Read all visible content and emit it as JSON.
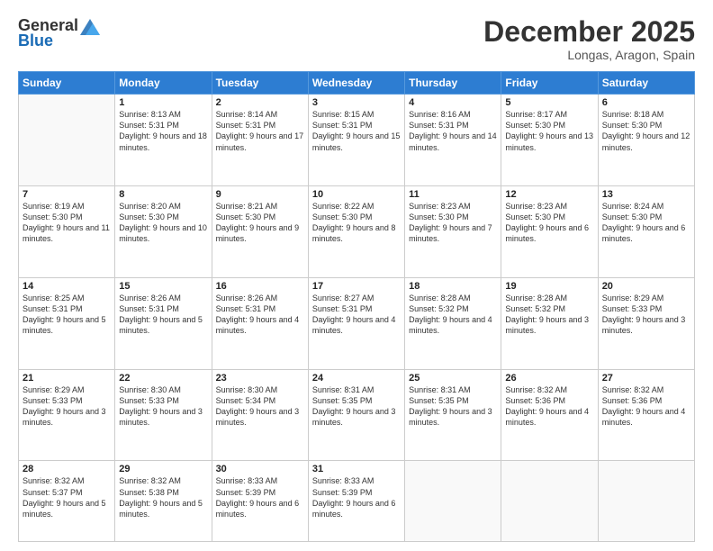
{
  "logo": {
    "general": "General",
    "blue": "Blue"
  },
  "title": {
    "month": "December 2025",
    "location": "Longas, Aragon, Spain"
  },
  "weekdays": [
    "Sunday",
    "Monday",
    "Tuesday",
    "Wednesday",
    "Thursday",
    "Friday",
    "Saturday"
  ],
  "weeks": [
    [
      {
        "day": "",
        "sunrise": "",
        "sunset": "",
        "daylight": ""
      },
      {
        "day": "1",
        "sunrise": "Sunrise: 8:13 AM",
        "sunset": "Sunset: 5:31 PM",
        "daylight": "Daylight: 9 hours and 18 minutes."
      },
      {
        "day": "2",
        "sunrise": "Sunrise: 8:14 AM",
        "sunset": "Sunset: 5:31 PM",
        "daylight": "Daylight: 9 hours and 17 minutes."
      },
      {
        "day": "3",
        "sunrise": "Sunrise: 8:15 AM",
        "sunset": "Sunset: 5:31 PM",
        "daylight": "Daylight: 9 hours and 15 minutes."
      },
      {
        "day": "4",
        "sunrise": "Sunrise: 8:16 AM",
        "sunset": "Sunset: 5:31 PM",
        "daylight": "Daylight: 9 hours and 14 minutes."
      },
      {
        "day": "5",
        "sunrise": "Sunrise: 8:17 AM",
        "sunset": "Sunset: 5:30 PM",
        "daylight": "Daylight: 9 hours and 13 minutes."
      },
      {
        "day": "6",
        "sunrise": "Sunrise: 8:18 AM",
        "sunset": "Sunset: 5:30 PM",
        "daylight": "Daylight: 9 hours and 12 minutes."
      }
    ],
    [
      {
        "day": "7",
        "sunrise": "Sunrise: 8:19 AM",
        "sunset": "Sunset: 5:30 PM",
        "daylight": "Daylight: 9 hours and 11 minutes."
      },
      {
        "day": "8",
        "sunrise": "Sunrise: 8:20 AM",
        "sunset": "Sunset: 5:30 PM",
        "daylight": "Daylight: 9 hours and 10 minutes."
      },
      {
        "day": "9",
        "sunrise": "Sunrise: 8:21 AM",
        "sunset": "Sunset: 5:30 PM",
        "daylight": "Daylight: 9 hours and 9 minutes."
      },
      {
        "day": "10",
        "sunrise": "Sunrise: 8:22 AM",
        "sunset": "Sunset: 5:30 PM",
        "daylight": "Daylight: 9 hours and 8 minutes."
      },
      {
        "day": "11",
        "sunrise": "Sunrise: 8:23 AM",
        "sunset": "Sunset: 5:30 PM",
        "daylight": "Daylight: 9 hours and 7 minutes."
      },
      {
        "day": "12",
        "sunrise": "Sunrise: 8:23 AM",
        "sunset": "Sunset: 5:30 PM",
        "daylight": "Daylight: 9 hours and 6 minutes."
      },
      {
        "day": "13",
        "sunrise": "Sunrise: 8:24 AM",
        "sunset": "Sunset: 5:30 PM",
        "daylight": "Daylight: 9 hours and 6 minutes."
      }
    ],
    [
      {
        "day": "14",
        "sunrise": "Sunrise: 8:25 AM",
        "sunset": "Sunset: 5:31 PM",
        "daylight": "Daylight: 9 hours and 5 minutes."
      },
      {
        "day": "15",
        "sunrise": "Sunrise: 8:26 AM",
        "sunset": "Sunset: 5:31 PM",
        "daylight": "Daylight: 9 hours and 5 minutes."
      },
      {
        "day": "16",
        "sunrise": "Sunrise: 8:26 AM",
        "sunset": "Sunset: 5:31 PM",
        "daylight": "Daylight: 9 hours and 4 minutes."
      },
      {
        "day": "17",
        "sunrise": "Sunrise: 8:27 AM",
        "sunset": "Sunset: 5:31 PM",
        "daylight": "Daylight: 9 hours and 4 minutes."
      },
      {
        "day": "18",
        "sunrise": "Sunrise: 8:28 AM",
        "sunset": "Sunset: 5:32 PM",
        "daylight": "Daylight: 9 hours and 4 minutes."
      },
      {
        "day": "19",
        "sunrise": "Sunrise: 8:28 AM",
        "sunset": "Sunset: 5:32 PM",
        "daylight": "Daylight: 9 hours and 3 minutes."
      },
      {
        "day": "20",
        "sunrise": "Sunrise: 8:29 AM",
        "sunset": "Sunset: 5:33 PM",
        "daylight": "Daylight: 9 hours and 3 minutes."
      }
    ],
    [
      {
        "day": "21",
        "sunrise": "Sunrise: 8:29 AM",
        "sunset": "Sunset: 5:33 PM",
        "daylight": "Daylight: 9 hours and 3 minutes."
      },
      {
        "day": "22",
        "sunrise": "Sunrise: 8:30 AM",
        "sunset": "Sunset: 5:33 PM",
        "daylight": "Daylight: 9 hours and 3 minutes."
      },
      {
        "day": "23",
        "sunrise": "Sunrise: 8:30 AM",
        "sunset": "Sunset: 5:34 PM",
        "daylight": "Daylight: 9 hours and 3 minutes."
      },
      {
        "day": "24",
        "sunrise": "Sunrise: 8:31 AM",
        "sunset": "Sunset: 5:35 PM",
        "daylight": "Daylight: 9 hours and 3 minutes."
      },
      {
        "day": "25",
        "sunrise": "Sunrise: 8:31 AM",
        "sunset": "Sunset: 5:35 PM",
        "daylight": "Daylight: 9 hours and 3 minutes."
      },
      {
        "day": "26",
        "sunrise": "Sunrise: 8:32 AM",
        "sunset": "Sunset: 5:36 PM",
        "daylight": "Daylight: 9 hours and 4 minutes."
      },
      {
        "day": "27",
        "sunrise": "Sunrise: 8:32 AM",
        "sunset": "Sunset: 5:36 PM",
        "daylight": "Daylight: 9 hours and 4 minutes."
      }
    ],
    [
      {
        "day": "28",
        "sunrise": "Sunrise: 8:32 AM",
        "sunset": "Sunset: 5:37 PM",
        "daylight": "Daylight: 9 hours and 5 minutes."
      },
      {
        "day": "29",
        "sunrise": "Sunrise: 8:32 AM",
        "sunset": "Sunset: 5:38 PM",
        "daylight": "Daylight: 9 hours and 5 minutes."
      },
      {
        "day": "30",
        "sunrise": "Sunrise: 8:33 AM",
        "sunset": "Sunset: 5:39 PM",
        "daylight": "Daylight: 9 hours and 6 minutes."
      },
      {
        "day": "31",
        "sunrise": "Sunrise: 8:33 AM",
        "sunset": "Sunset: 5:39 PM",
        "daylight": "Daylight: 9 hours and 6 minutes."
      },
      {
        "day": "",
        "sunrise": "",
        "sunset": "",
        "daylight": ""
      },
      {
        "day": "",
        "sunrise": "",
        "sunset": "",
        "daylight": ""
      },
      {
        "day": "",
        "sunrise": "",
        "sunset": "",
        "daylight": ""
      }
    ]
  ]
}
